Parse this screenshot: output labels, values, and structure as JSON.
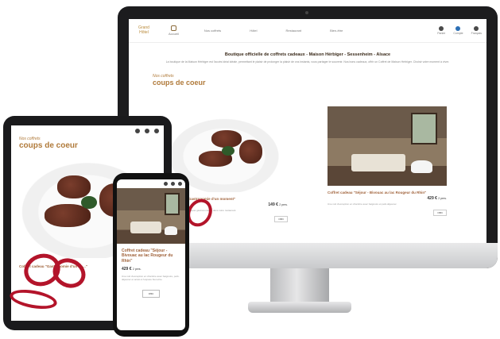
{
  "desktop": {
    "logo": "Grand Hôtel",
    "nav_items": [
      {
        "label": "Accueil",
        "icon": "home-icon"
      },
      {
        "label": "Nos coffrets",
        "icon": "gift-icon"
      },
      {
        "label": "Hôtel",
        "icon": "hotel-icon"
      },
      {
        "label": "Restaurant",
        "icon": "restaurant-icon"
      },
      {
        "label": "Bien-être",
        "icon": "spa-icon"
      }
    ],
    "right_items": [
      "Panier",
      "Compte",
      "Français"
    ],
    "title": "Boutique officielle de coffrets cadeaux - Maison Hérbiger - Sessenheim - Alsace",
    "intro": "La boutique de la Maison Hérbiger est l'accès idéal idéale, permettant le plaisir de prolonger la plaisir de vos instants, vous partager le souvenir. Nos bons cadeaux, offrir un Coffret de Maison Hérbiger. Choisir votre moment à vivre.",
    "kicker": "Nos coffrets",
    "heading": "coups de coeur",
    "cards": [
      {
        "name": "Coffret cadeau \"Gastronomie d'un moment\"",
        "price": "149 €",
        "unit": "2 pers.",
        "desc": "Un coffret pour partager un repas gastronomique dans notre restaurant.",
        "button": "Offrir"
      },
      {
        "name": "Coffret cadeau \"Séjour - Bivouac au lac Rougeur du Rhin\"",
        "price": "429 €",
        "unit": "2 pers.",
        "desc": "Une nuit d'exception en chambre avec baignoire et petit-déjeuner.",
        "button": "Offrir"
      }
    ]
  },
  "tablet": {
    "kicker": "Nos coffrets",
    "heading": "coups de coeur",
    "card_name": "Coffret cadeau \"Gastronomie d'un fin...\""
  },
  "phone": {
    "card_name": "Coffret cadeau \"Séjour - Bivouac au lac Rougeur du Rhin\"",
    "price": "429 €",
    "unit": "2 pers.",
    "desc": "Une nuit d'exception en chambre avec baignoire, petit-déjeuner et accès à l'espace bien-être.",
    "button": "Offrir"
  },
  "colors": {
    "accent": "#b07a3a",
    "product_name": "#a0623a",
    "ribbon": "#b3142a"
  }
}
